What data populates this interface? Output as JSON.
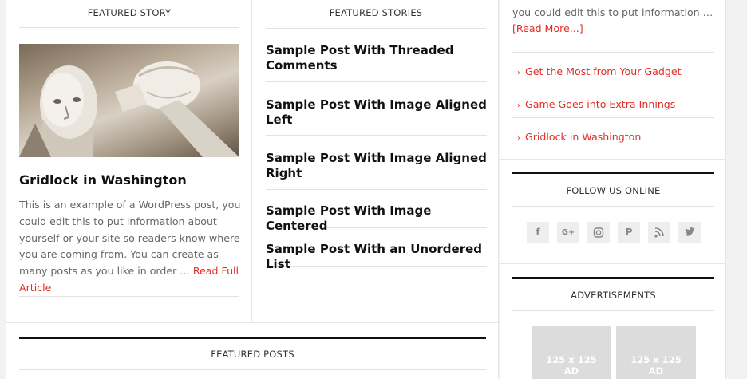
{
  "featured_story": {
    "title": "FEATURED STORY",
    "post_title": "Gridlock in Washington",
    "excerpt": "This is an example of a WordPress post, you could edit this to put information about yourself or your site so readers know where you are coming from. You can create as many posts as you like in order … ",
    "read_more": "Read Full Article"
  },
  "featured_stories": {
    "title": "FEATURED STORIES",
    "items": [
      "Sample Post With Threaded Comments",
      "Sample Post With Image Aligned Left",
      "Sample Post With Image Aligned Right",
      "Sample Post With Image Centered",
      "Sample Post With an Unordered List"
    ]
  },
  "featured_posts": {
    "title": "FEATURED POSTS"
  },
  "sidebar": {
    "excerpt": "you could edit this to put information … ",
    "read_more": "[Read More...]",
    "links": [
      "Get the Most from Your Gadget",
      "Game Goes into Extra Innings",
      "Gridlock in Washington"
    ],
    "follow_title": "FOLLOW US ONLINE",
    "social_icons": [
      "facebook-icon",
      "google-plus-icon",
      "instagram-icon",
      "pinterest-icon",
      "rss-icon",
      "twitter-icon"
    ],
    "ads_title": "ADVERTISEMENTS",
    "ads": [
      {
        "size": "125 x 125",
        "label": "AD"
      },
      {
        "size": "125 x 125",
        "label": "AD"
      }
    ]
  },
  "colors": {
    "accent": "#e22d27",
    "heading": "#111111",
    "body_text": "#666666"
  }
}
